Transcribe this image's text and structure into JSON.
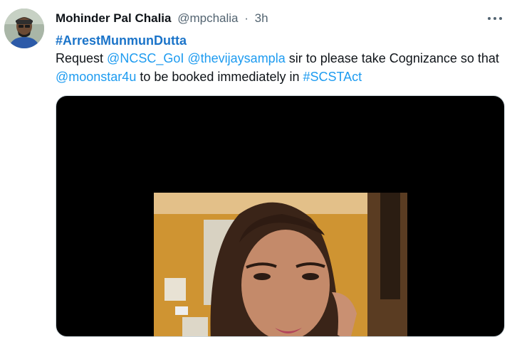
{
  "tweet": {
    "author_name": "Mohinder Pal Chalia",
    "handle": "@mpchalia",
    "separator": "·",
    "time": "3h",
    "hashtag_headline": "#ArrestMunmunDutta",
    "body": {
      "request": "Request ",
      "mention1": "@NCSC_GoI",
      "mention2": "@thevijaysampla",
      "middle": " sir to please take Cognizance so that ",
      "mention3": "@moonstar4u",
      "tail": " to be booked immediately in ",
      "hashtag": "#SCSTAct"
    }
  },
  "colors": {
    "link": "#1d9bf0",
    "headline_hashtag": "#1b74c9",
    "meta": "#536471"
  },
  "icons": {
    "more": "more-horizontal-icon"
  }
}
